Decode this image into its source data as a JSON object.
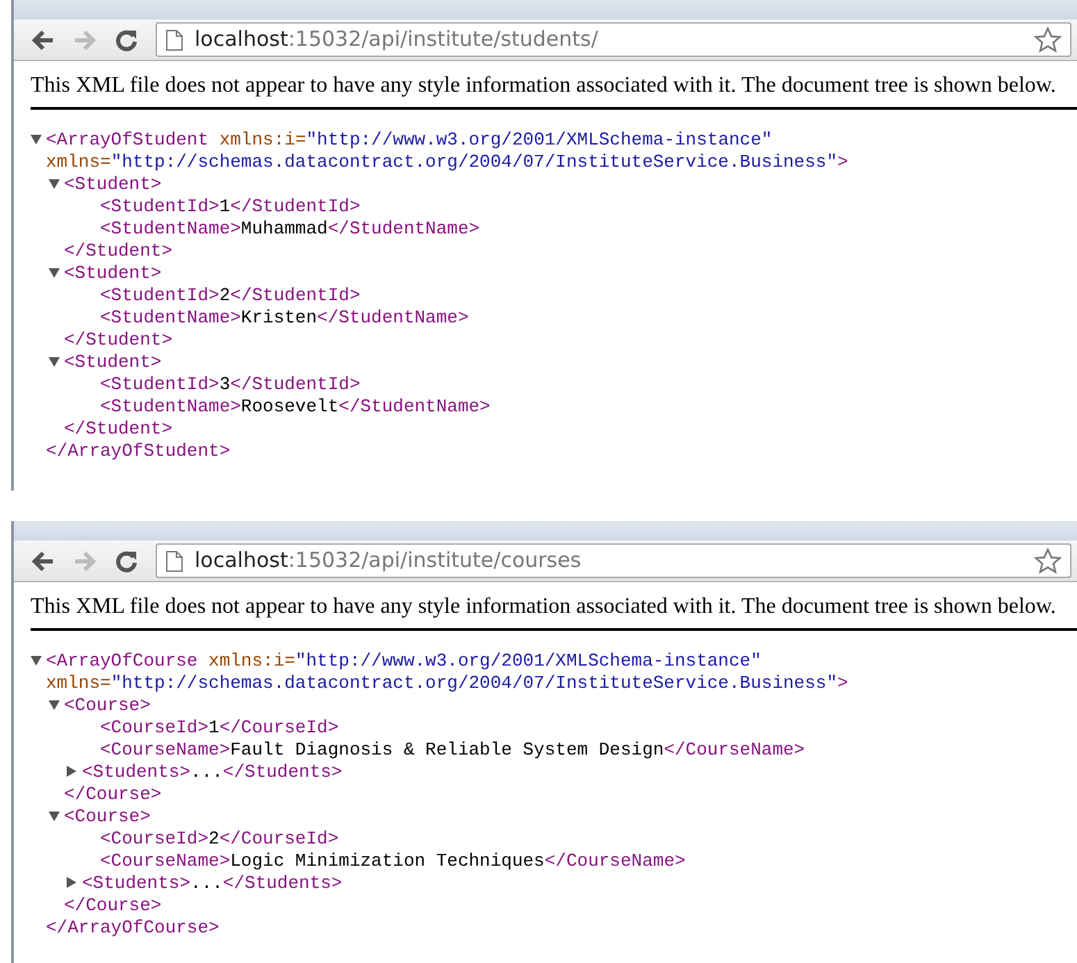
{
  "windows": [
    {
      "url": {
        "host": "localhost",
        "path": ":15032/api/institute/students/"
      },
      "notice": "This XML file does not appear to have any style information associated with it. The document tree is shown below.",
      "tree": {
        "kind": "element",
        "expanded": true,
        "open_lines": [
          [
            {
              "kind": "tag",
              "text": "<ArrayOfStudent"
            },
            {
              "kind": "attr",
              "text": " xmlns:i="
            },
            {
              "kind": "value",
              "text": "\"http://www.w3.org/2001/XMLSchema-instance\""
            }
          ],
          [
            {
              "kind": "attr",
              "text": "xmlns="
            },
            {
              "kind": "value",
              "text": "\"http://schemas.datacontract.org/2004/07/InstituteService.Business\""
            },
            {
              "kind": "tag",
              "text": ">"
            }
          ]
        ],
        "close": "</ArrayOfStudent>",
        "children": [
          {
            "kind": "element",
            "expanded": true,
            "open_lines": [
              [
                {
                  "kind": "tag",
                  "text": "<Student>"
                }
              ]
            ],
            "close": "</Student>",
            "children": [
              {
                "kind": "leaf",
                "open": "<StudentId>",
                "text": "1",
                "close": "</StudentId>"
              },
              {
                "kind": "leaf",
                "open": "<StudentName>",
                "text": "Muhammad",
                "close": "</StudentName>"
              }
            ]
          },
          {
            "kind": "element",
            "expanded": true,
            "open_lines": [
              [
                {
                  "kind": "tag",
                  "text": "<Student>"
                }
              ]
            ],
            "close": "</Student>",
            "children": [
              {
                "kind": "leaf",
                "open": "<StudentId>",
                "text": "2",
                "close": "</StudentId>"
              },
              {
                "kind": "leaf",
                "open": "<StudentName>",
                "text": "Kristen",
                "close": "</StudentName>"
              }
            ]
          },
          {
            "kind": "element",
            "expanded": true,
            "open_lines": [
              [
                {
                  "kind": "tag",
                  "text": "<Student>"
                }
              ]
            ],
            "close": "</Student>",
            "children": [
              {
                "kind": "leaf",
                "open": "<StudentId>",
                "text": "3",
                "close": "</StudentId>"
              },
              {
                "kind": "leaf",
                "open": "<StudentName>",
                "text": "Roosevelt",
                "close": "</StudentName>"
              }
            ]
          }
        ]
      }
    },
    {
      "url": {
        "host": "localhost",
        "path": ":15032/api/institute/courses"
      },
      "notice": "This XML file does not appear to have any style information associated with it. The document tree is shown below.",
      "tree": {
        "kind": "element",
        "expanded": true,
        "open_lines": [
          [
            {
              "kind": "tag",
              "text": "<ArrayOfCourse"
            },
            {
              "kind": "attr",
              "text": " xmlns:i="
            },
            {
              "kind": "value",
              "text": "\"http://www.w3.org/2001/XMLSchema-instance\""
            }
          ],
          [
            {
              "kind": "attr",
              "text": "xmlns="
            },
            {
              "kind": "value",
              "text": "\"http://schemas.datacontract.org/2004/07/InstituteService.Business\""
            },
            {
              "kind": "tag",
              "text": ">"
            }
          ]
        ],
        "close": "</ArrayOfCourse>",
        "children": [
          {
            "kind": "element",
            "expanded": true,
            "open_lines": [
              [
                {
                  "kind": "tag",
                  "text": "<Course>"
                }
              ]
            ],
            "close": "</Course>",
            "children": [
              {
                "kind": "leaf",
                "open": "<CourseId>",
                "text": "1",
                "close": "</CourseId>"
              },
              {
                "kind": "leaf",
                "open": "<CourseName>",
                "text": "Fault Diagnosis & Reliable System Design",
                "close": "</CourseName>"
              },
              {
                "kind": "element",
                "expanded": false,
                "open_lines": [
                  [
                    {
                      "kind": "tag",
                      "text": "<Students>"
                    }
                  ]
                ],
                "ellipsis": "...",
                "close": "</Students>"
              }
            ]
          },
          {
            "kind": "element",
            "expanded": true,
            "open_lines": [
              [
                {
                  "kind": "tag",
                  "text": "<Course>"
                }
              ]
            ],
            "close": "</Course>",
            "children": [
              {
                "kind": "leaf",
                "open": "<CourseId>",
                "text": "2",
                "close": "</CourseId>"
              },
              {
                "kind": "leaf",
                "open": "<CourseName>",
                "text": "Logic Minimization Techniques",
                "close": "</CourseName>"
              },
              {
                "kind": "element",
                "expanded": false,
                "open_lines": [
                  [
                    {
                      "kind": "tag",
                      "text": "<Students>"
                    }
                  ]
                ],
                "ellipsis": "...",
                "close": "</Students>"
              }
            ]
          }
        ]
      }
    }
  ]
}
